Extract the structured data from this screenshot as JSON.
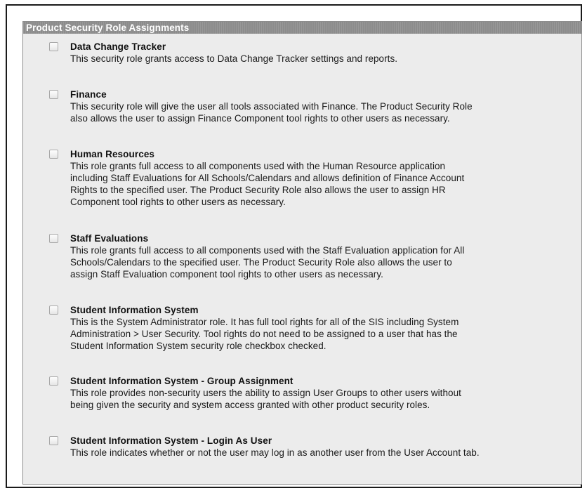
{
  "panel": {
    "title": "Product Security Role Assignments"
  },
  "roles": [
    {
      "title": "Data Change Tracker",
      "checked": false,
      "description_lines": [
        "This security role grants access to Data Change Tracker settings and reports."
      ]
    },
    {
      "title": "Finance",
      "checked": false,
      "description_lines": [
        "This security role will give the user all tools associated with Finance. The Product Security Role",
        "also allows the user to assign Finance Component tool rights to other users as necessary."
      ]
    },
    {
      "title": "Human Resources",
      "checked": false,
      "description_lines": [
        "This role grants full access to all components used with the Human Resource application",
        "including Staff Evaluations for All Schools/Calendars and allows definition of Finance Account",
        "Rights to the specified user. The Product Security Role also allows the user to assign HR",
        "Component tool rights to other users as necessary."
      ]
    },
    {
      "title": "Staff Evaluations",
      "checked": false,
      "description_lines": [
        "This role grants full access to all components used with the Staff Evaluation application for All",
        "Schools/Calendars to the specified user. The Product Security Role also allows the user to",
        "assign Staff Evaluation component tool rights to other users as necessary."
      ]
    },
    {
      "title": "Student Information System",
      "checked": false,
      "description_lines": [
        "This is the System Administrator role. It has full tool rights for all of the SIS including System",
        "Administration > User Security. Tool rights do not need to be assigned to a user that has the",
        "Student Information System security role checkbox checked."
      ]
    },
    {
      "title": "Student Information System - Group Assignment",
      "checked": false,
      "description_lines": [
        "This role provides non-security users the ability to assign User Groups to other users without",
        "being given the security and system access granted with other product security roles."
      ]
    },
    {
      "title": "Student Information System - Login As User",
      "checked": false,
      "description_lines": [
        "This role indicates whether or not the user may log in as another user from the User Account tab."
      ]
    }
  ]
}
